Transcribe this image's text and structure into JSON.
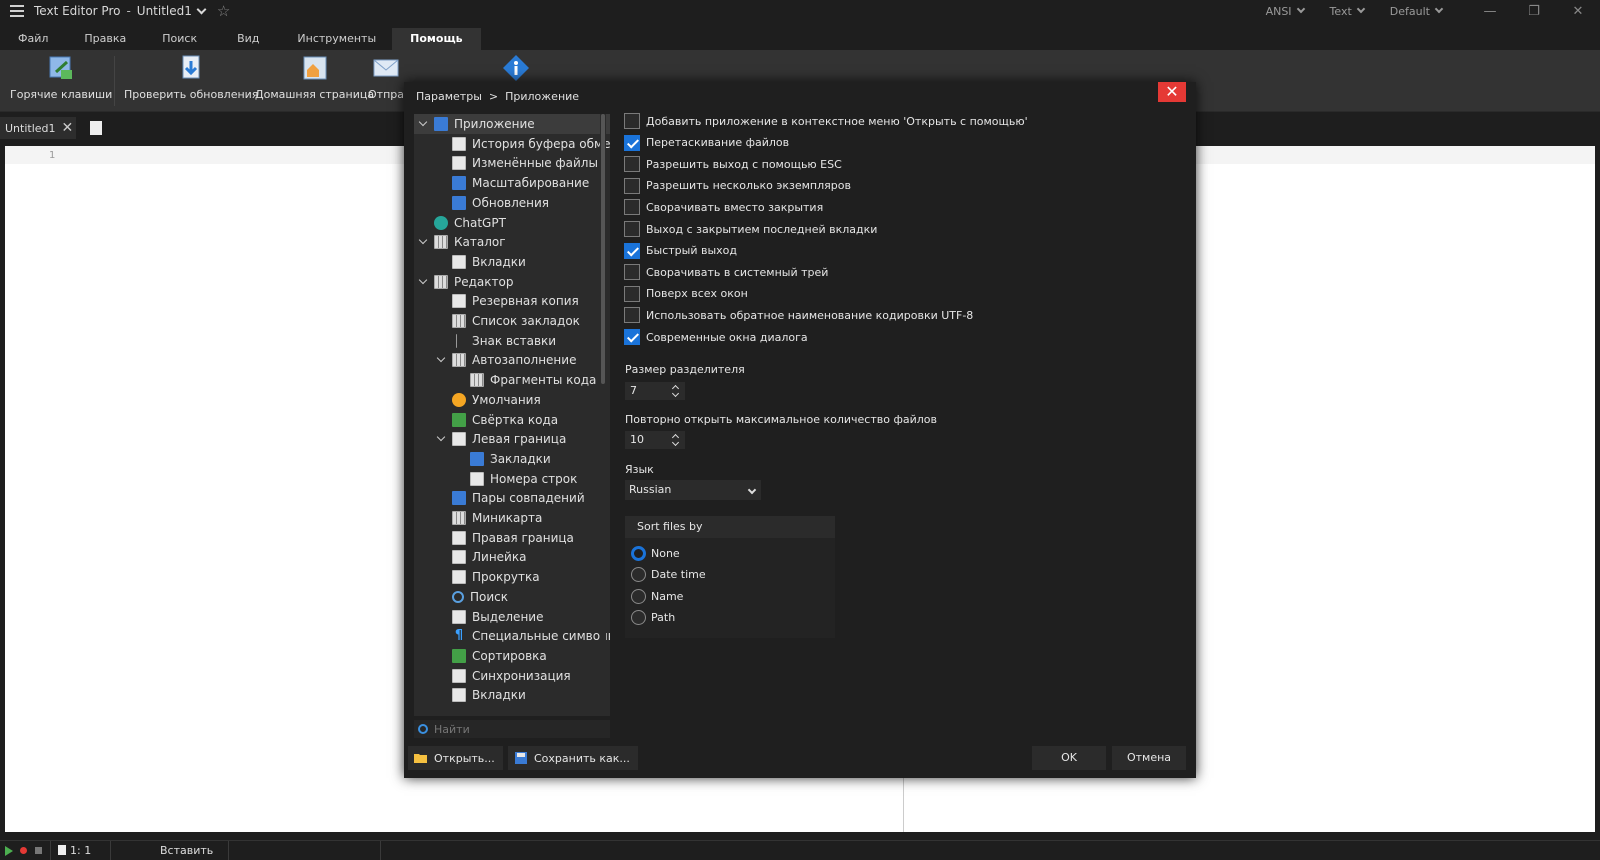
{
  "titlebar": {
    "app_name": "Text Editor Pro",
    "separator": "-",
    "doc_name": "Untitled1",
    "encoding": "ANSI",
    "highlighter": "Text",
    "theme": "Default"
  },
  "ribbon": {
    "tabs": [
      "Файл",
      "Правка",
      "Поиск",
      "Вид",
      "Инструменты",
      "Помощь"
    ],
    "active_tab": "Помощь",
    "buttons": [
      "Горячие клавиши",
      "Проверить обновления",
      "Домашняя страница",
      "Отпра"
    ]
  },
  "doc_tab": {
    "label": "Untitled1"
  },
  "editor": {
    "line_number": "1"
  },
  "statusbar": {
    "position": "1: 1",
    "mode": "Вставить"
  },
  "dialog": {
    "breadcrumb": {
      "parent": "Параметры",
      "sep": ">",
      "current": "Приложение"
    },
    "tree": [
      {
        "label": "Приложение",
        "level": 0,
        "expanded": true,
        "selected": true,
        "icon": "window-icon"
      },
      {
        "label": "История буфера обмена",
        "level": 1,
        "icon": "clipboard-icon"
      },
      {
        "label": "Изменённые файлы",
        "level": 1,
        "icon": "edit-file-icon"
      },
      {
        "label": "Масштабирование",
        "level": 1,
        "icon": "zoom-icon"
      },
      {
        "label": "Обновления",
        "level": 1,
        "icon": "update-icon"
      },
      {
        "label": "ChatGPT",
        "level": 0,
        "icon": "chatgpt-icon"
      },
      {
        "label": "Каталог",
        "level": 0,
        "expanded": true,
        "icon": "catalog-icon"
      },
      {
        "label": "Вкладки",
        "level": 1,
        "icon": "tabs-icon"
      },
      {
        "label": "Редактор",
        "level": 0,
        "expanded": true,
        "icon": "editor-icon"
      },
      {
        "label": "Резервная копия",
        "level": 1,
        "icon": "backup-icon"
      },
      {
        "label": "Список закладок",
        "level": 1,
        "icon": "bookmark-list-icon"
      },
      {
        "label": "Знак вставки",
        "level": 1,
        "icon": "caret-icon"
      },
      {
        "label": "Автозаполнение",
        "level": 1,
        "expanded": true,
        "icon": "autocomplete-icon"
      },
      {
        "label": "Фрагменты кода",
        "level": 2,
        "icon": "code-snippet-icon"
      },
      {
        "label": "Умолчания",
        "level": 1,
        "icon": "defaults-icon"
      },
      {
        "label": "Свёртка кода",
        "level": 1,
        "icon": "code-folding-icon"
      },
      {
        "label": "Левая граница",
        "level": 1,
        "expanded": true,
        "icon": "left-margin-icon"
      },
      {
        "label": "Закладки",
        "level": 2,
        "icon": "bookmarks-icon"
      },
      {
        "label": "Номера строк",
        "level": 2,
        "icon": "line-numbers-icon"
      },
      {
        "label": "Пары совпадений",
        "level": 1,
        "icon": "matching-pairs-icon"
      },
      {
        "label": "Миникарта",
        "level": 1,
        "icon": "minimap-icon"
      },
      {
        "label": "Правая граница",
        "level": 1,
        "icon": "right-margin-icon"
      },
      {
        "label": "Линейка",
        "level": 1,
        "icon": "ruler-icon"
      },
      {
        "label": "Прокрутка",
        "level": 1,
        "icon": "scroll-icon"
      },
      {
        "label": "Поиск",
        "level": 1,
        "icon": "search-icon"
      },
      {
        "label": "Выделение",
        "level": 1,
        "icon": "selection-icon"
      },
      {
        "label": "Специальные символы",
        "level": 1,
        "icon": "special-chars-icon"
      },
      {
        "label": "Сортировка",
        "level": 1,
        "icon": "sort-icon"
      },
      {
        "label": "Синхронизация",
        "level": 1,
        "icon": "sync-icon"
      },
      {
        "label": "Вкладки",
        "level": 1,
        "icon": "tabs-icon"
      }
    ],
    "tree_search_placeholder": "Найти",
    "options": [
      {
        "label": "Добавить приложение в контекстное меню 'Открыть с помощью'",
        "checked": false
      },
      {
        "label": "Перетаскивание файлов",
        "checked": true
      },
      {
        "label": "Разрешить выход с помощью ESC",
        "checked": false
      },
      {
        "label": "Разрешить несколько экземпляров",
        "checked": false
      },
      {
        "label": "Сворачивать вместо закрытия",
        "checked": false
      },
      {
        "label": "Выход с закрытием последней вкладки",
        "checked": false
      },
      {
        "label": "Быстрый выход",
        "checked": true
      },
      {
        "label": "Сворачивать в системный трей",
        "checked": false
      },
      {
        "label": "Поверх всех окон",
        "checked": false
      },
      {
        "label": "Использовать обратное наименование кодировки UTF-8",
        "checked": false
      },
      {
        "label": "Современные окна диалога",
        "checked": true
      }
    ],
    "splitter_size": {
      "label": "Размер разделителя",
      "value": "7"
    },
    "reopen_max": {
      "label": "Повторно открыть максимальное количество файлов",
      "value": "10"
    },
    "language": {
      "label": "Язык",
      "value": "Russian"
    },
    "sort_group": {
      "title": "Sort files by",
      "options": [
        "None",
        "Date time",
        "Name",
        "Path"
      ],
      "selected": "None"
    },
    "footer": {
      "open": "Открыть...",
      "save_as": "Сохранить как...",
      "ok": "OK",
      "cancel": "Отмена"
    }
  },
  "colors": {
    "accent": "#1a73d9",
    "close": "#e53935",
    "dialog_bg": "#1f1f1f",
    "panel_bg": "#2b2b2b"
  }
}
